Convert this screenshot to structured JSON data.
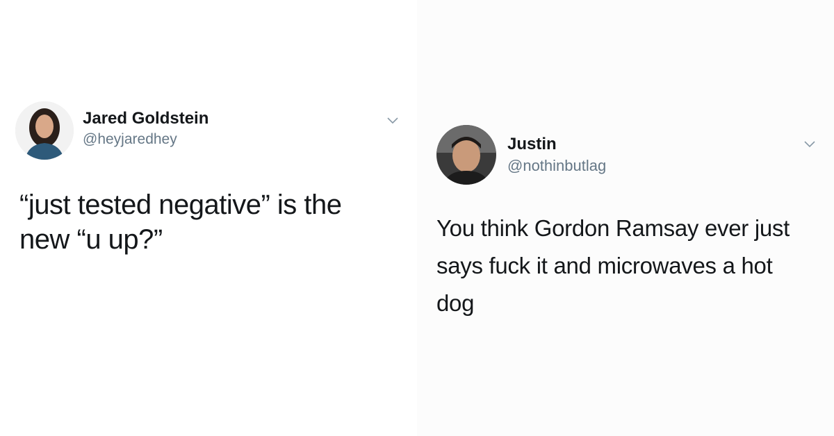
{
  "tweets": [
    {
      "display_name": "Jared Goldstein",
      "handle": "@heyjaredhey",
      "text": "“just tested negative” is the new “u up?”",
      "avatar_icon": "profile-photo",
      "menu_icon": "chevron-down-icon"
    },
    {
      "display_name": "Justin",
      "handle": "@nothinbutlag",
      "text": "You think Gordon Ramsay ever just says fuck it and microwaves a hot dog",
      "avatar_icon": "profile-photo",
      "menu_icon": "chevron-down-icon"
    }
  ],
  "colors": {
    "name": "#14171a",
    "handle": "#657786",
    "chevron": "#8899a6",
    "background": "#ffffff"
  }
}
